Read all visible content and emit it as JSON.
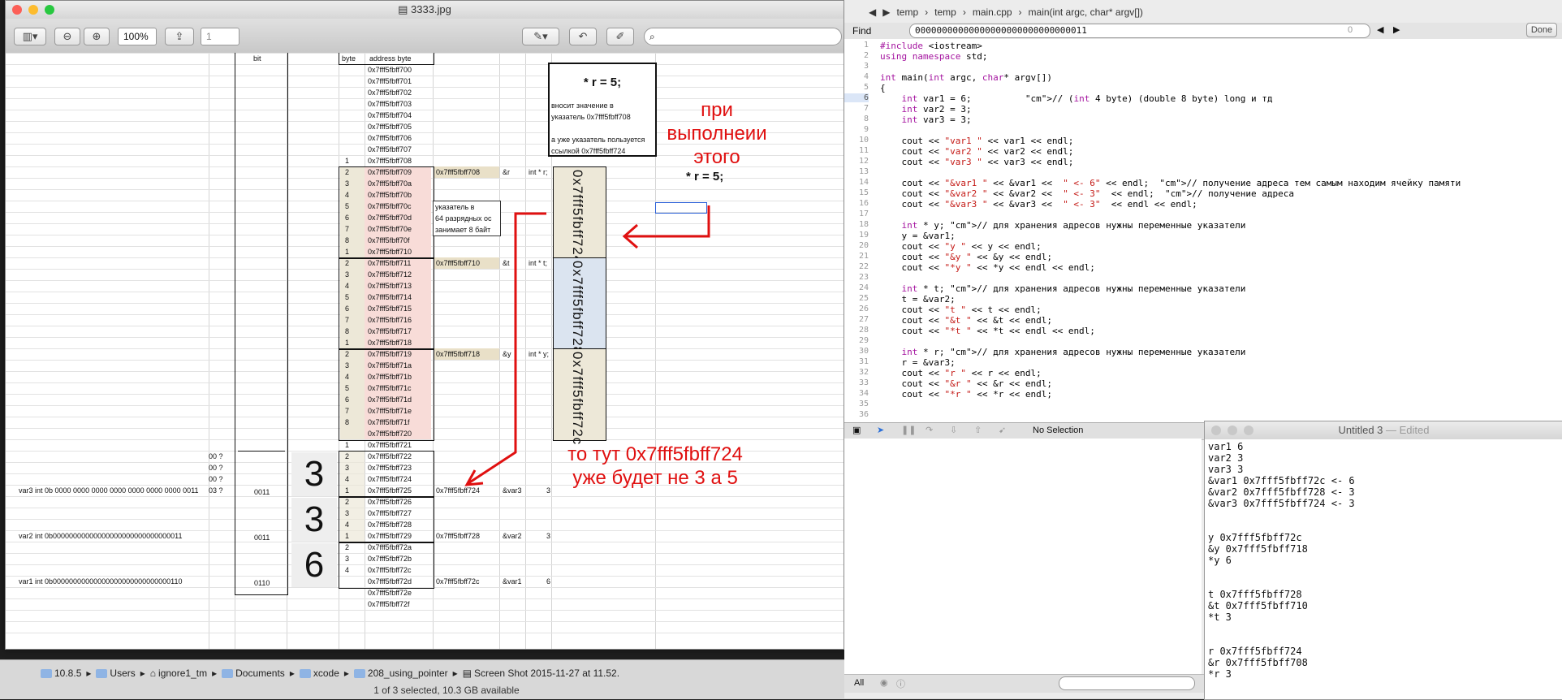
{
  "preview": {
    "title": "3333.jpg",
    "zoom": "100%",
    "page": "1",
    "colors": {
      "pink": "#f8dcd8",
      "blue": "#dbe4f0",
      "beige": "#ede8d8",
      "tan": "#e9e0c8",
      "red": "#e01010"
    },
    "sheet": {
      "hdr_bit": "bit",
      "hdr_byte": "byte",
      "hdr_address": "address byte",
      "addresses": [
        "0x7fff5fbff700",
        "0x7fff5fbff701",
        "0x7fff5fbff702",
        "0x7fff5fbff703",
        "0x7fff5fbff704",
        "0x7fff5fbff705",
        "0x7fff5fbff706",
        "0x7fff5fbff707",
        "0x7fff5fbff708",
        "0x7fff5fbff709",
        "0x7fff5fbff70a",
        "0x7fff5fbff70b",
        "0x7fff5fbff70c",
        "0x7fff5fbff70d",
        "0x7fff5fbff70e",
        "0x7fff5fbff70f",
        "0x7fff5fbff710",
        "0x7fff5fbff711",
        "0x7fff5fbff712",
        "0x7fff5fbff713",
        "0x7fff5fbff714",
        "0x7fff5fbff715",
        "0x7fff5fbff716",
        "0x7fff5fbff717",
        "0x7fff5fbff718",
        "0x7fff5fbff719",
        "0x7fff5fbff71a",
        "0x7fff5fbff71b",
        "0x7fff5fbff71c",
        "0x7fff5fbff71d",
        "0x7fff5fbff71e",
        "0x7fff5fbff71f",
        "0x7fff5fbff720",
        "0x7fff5fbff721",
        "0x7fff5fbff722",
        "0x7fff5fbff723",
        "0x7fff5fbff724",
        "0x7fff5fbff725",
        "0x7fff5fbff726",
        "0x7fff5fbff727",
        "0x7fff5fbff728",
        "0x7fff5fbff729",
        "0x7fff5fbff72a",
        "0x7fff5fbff72b",
        "0x7fff5fbff72c",
        "0x7fff5fbff72d",
        "0x7fff5fbff72e",
        "0x7fff5fbff72f"
      ],
      "byte_nums": [
        "",
        "",
        "",
        "",
        "",
        "",
        "",
        "",
        "1",
        "2",
        "3",
        "4",
        "5",
        "6",
        "7",
        "8",
        "1",
        "2",
        "3",
        "4",
        "5",
        "6",
        "7",
        "8",
        "1",
        "2",
        "3",
        "4",
        "5",
        "6",
        "7",
        "8",
        "",
        "1",
        "2",
        "3",
        "4",
        "1",
        "2",
        "3",
        "4",
        "1",
        "2",
        "3",
        "4",
        "",
        "",
        ""
      ],
      "ptr_r_addr": "0x7fff5fbff708",
      "ptr_r_ref": "&r",
      "ptr_r_decl": "int * r;",
      "ptr_t_addr": "0x7fff5fbff710",
      "ptr_t_ref": "&t",
      "ptr_t_decl": "int * t;",
      "ptr_y_addr": "0x7fff5fbff718",
      "ptr_y_ref": "&y",
      "ptr_y_decl": "int * y;",
      "note_lines": [
        "указатель в",
        "64 разрядных ос",
        "занимает 8 байт"
      ],
      "var3_addr": "0x7fff5fbff724",
      "var3_ref": "&var3",
      "var3_val": "3",
      "var2_addr": "0x7fff5fbff728",
      "var2_ref": "&var2",
      "var2_val": "3",
      "var1_addr": "0x7fff5fbff72c",
      "var1_ref": "&var1",
      "var1_val": "6",
      "var3_desc": "var3 int 0b 0000 0000 0000 0000 0000 0000 0000 0011",
      "var2_desc": "var2 int 0b00000000000000000000000000000011",
      "var1_desc": "var1 int 0b00000000000000000000000000000110",
      "q_cells": [
        "00 ?",
        "00 ?",
        "00 ?",
        "03 ?"
      ],
      "bits_var3": "0011",
      "bits_var2": "0011",
      "bits_var1": "0110",
      "big_var3": "3",
      "big_var2": "3",
      "big_var1": "6",
      "box_title": "* r = 5;",
      "box_lines": [
        "вносит значение в",
        "указатель 0x7fff5fbff708",
        "",
        "а уже указатель пользуется",
        " ссылкой 0x7fff5fbff724"
      ],
      "vert_r": "0x7fff5fbff724",
      "vert_t": "0x7fff5fbff728",
      "vert_y": "0x7fff5fbff72c",
      "red_top": [
        "при",
        "выполнеии",
        "этого"
      ],
      "black_r5": "* r = 5;",
      "red_bottom": [
        "то тут 0x7fff5fbff724",
        "уже будет не 3 а 5"
      ]
    }
  },
  "finder": {
    "path": [
      "10.8.5",
      "Users",
      "ignore1_tm",
      "Documents",
      "xcode",
      "208_using_pointer",
      "Screen Shot 2015-11-27 at 11.52."
    ],
    "status": "1 of 3 selected, 10.3 GB available"
  },
  "xcode": {
    "breadcrumb": [
      "temp",
      "temp",
      "main.cpp",
      "main(int argc, char* argv[])"
    ],
    "find_label": "Find",
    "find_query": "00000000000000000000000000000011",
    "find_count": "0",
    "done_label": "Done",
    "code": [
      "#include <iostream>",
      "using namespace std;",
      "",
      "int main(int argc, char* argv[])",
      "{",
      "    int var1 = 6;          // (int 4 byte) (double 8 byte) long и тд",
      "    int var2 = 3;",
      "    int var3 = 3;",
      "",
      "    cout << \"var1 \" << var1 << endl;",
      "    cout << \"var2 \" << var2 << endl;",
      "    cout << \"var3 \" << var3 << endl;",
      "",
      "    cout << \"&var1 \" << &var1 <<  \" <- 6\" << endl;  // получение адреса тем самым находим ячейку памяти",
      "    cout << \"&var2 \" << &var2 <<  \" <- 3\"  << endl;  // получение адреса",
      "    cout << \"&var3 \" << &var3 <<  \" <- 3\"  << endl << endl;",
      "",
      "    int * y; // для хранения адресов нужны переменные указатели",
      "    y = &var1;",
      "    cout << \"y \" << y << endl;",
      "    cout << \"&y \" << &y << endl;",
      "    cout << \"*y \" << *y << endl << endl;",
      "",
      "    int * t; // для хранения адресов нужны переменные указатели",
      "    t = &var2;",
      "    cout << \"t \" << t << endl;",
      "    cout << \"&t \" << &t << endl;",
      "    cout << \"*t \" << *t << endl << endl;",
      "",
      "    int * r; // для хранения адресов нужны переменные указатели",
      "    r = &var3;",
      "    cout << \"r \" << r << endl;",
      "    cout << \"&r \" << &r << endl;",
      "    cout << \"*r \" << *r << endl;",
      "",
      ""
    ],
    "line_numbers": [
      "1",
      "2",
      "3",
      "4",
      "5",
      "6",
      "7",
      "8",
      "9",
      "10",
      "11",
      "12",
      "13",
      "14",
      "15",
      "16",
      "17",
      "18",
      "19",
      "20",
      "21",
      "22",
      "23",
      "24",
      "25",
      "26",
      "27",
      "28",
      "29",
      "30",
      "31",
      "32",
      "33",
      "34",
      "35",
      "36"
    ],
    "debug_status": "No Selection",
    "bottom_filter": "All"
  },
  "textedit": {
    "title": "Untitled 3",
    "title_suffix": " — Edited",
    "lines": [
      "var1 6",
      "var2 3",
      "var3 3",
      "&var1 0x7fff5fbff72c <- 6",
      "&var2 0x7fff5fbff728 <- 3",
      "&var3 0x7fff5fbff724 <- 3",
      "",
      "",
      "y 0x7fff5fbff72c",
      "&y 0x7fff5fbff718",
      "*y 6",
      "",
      "",
      "t 0x7fff5fbff728",
      "&t 0x7fff5fbff710",
      "*t 3",
      "",
      "",
      "r 0x7fff5fbff724",
      "&r 0x7fff5fbff708",
      "*r 3"
    ]
  }
}
